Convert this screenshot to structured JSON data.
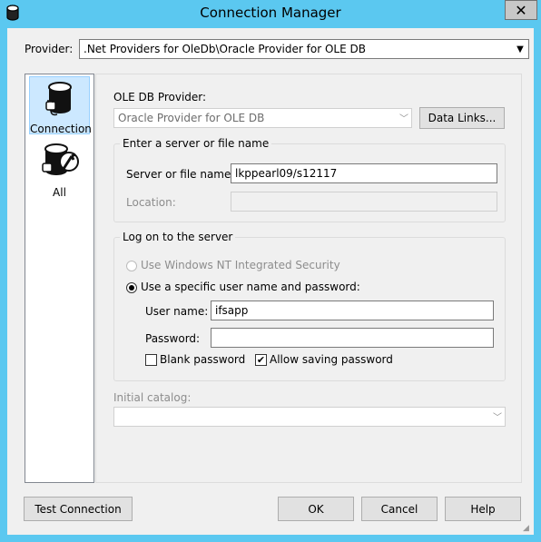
{
  "window": {
    "title": "Connection Manager",
    "close_glyph": "✕"
  },
  "provider": {
    "label": "Provider:",
    "value": ".Net Providers for OleDb\\Oracle Provider for OLE DB"
  },
  "sidebar": {
    "items": [
      {
        "label": "Connection",
        "icon": "database-plug-icon",
        "selected": true
      },
      {
        "label": "All",
        "icon": "database-wrench-icon",
        "selected": false
      }
    ]
  },
  "panel": {
    "oledb_provider_label": "OLE DB Provider:",
    "oledb_provider_value": "Oracle Provider for OLE DB",
    "data_links_button": "Data Links...",
    "server_group": {
      "title": "Enter a server or file name",
      "server_label": "Server or file name:",
      "server_value": "lkppearl09/s12117",
      "location_label": "Location:",
      "location_value": ""
    },
    "logon_group": {
      "title": "Log on to the server",
      "windows_security_label": "Use Windows NT Integrated Security",
      "specific_user_label": "Use a specific user name and password:",
      "specific_user_selected": true,
      "username_label": "User name:",
      "username_value": "ifsapp",
      "password_label": "Password:",
      "password_value": "",
      "blank_password_label": "Blank password",
      "blank_password_checked": false,
      "allow_saving_label": "Allow saving password",
      "allow_saving_checked": true,
      "check_glyph": "✔"
    },
    "initial_catalog_label": "Initial catalog:",
    "initial_catalog_value": ""
  },
  "footer": {
    "test_connection_button": "Test Connection",
    "ok_button": "OK",
    "cancel_button": "Cancel",
    "help_button": "Help"
  },
  "colors": {
    "titlebar": "#5bc8f0",
    "client": "#f0f0f0",
    "selection": "#cce8ff"
  }
}
